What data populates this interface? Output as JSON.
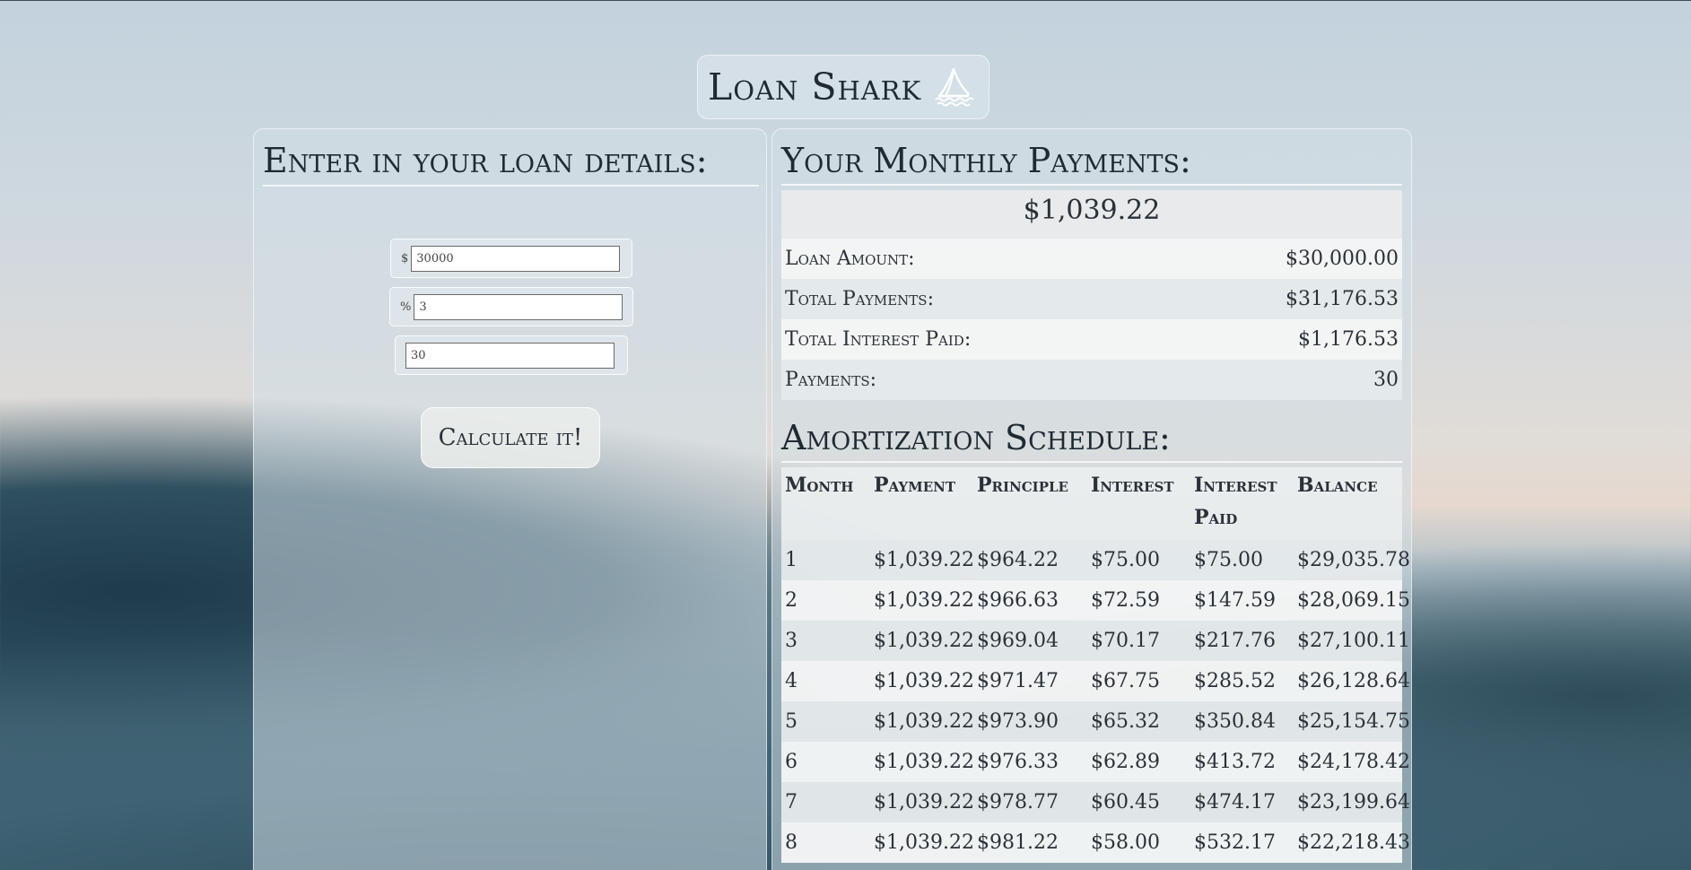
{
  "app": {
    "title": "Loan Shark"
  },
  "form": {
    "heading": "Enter in your loan details:",
    "amount": {
      "prefix": "$",
      "value": "30000"
    },
    "rate": {
      "prefix": "%",
      "value": "3"
    },
    "term": {
      "value": "30"
    },
    "calculate_label": "Calculate it!"
  },
  "results": {
    "heading": "Your Monthly Payments:",
    "monthly_payment": "$1,039.22",
    "summary": [
      {
        "label": "Loan Amount:",
        "value": "$30,000.00"
      },
      {
        "label": "Total Payments:",
        "value": "$31,176.53"
      },
      {
        "label": "Total Interest Paid:",
        "value": "$1,176.53"
      },
      {
        "label": "Payments:",
        "value": "30"
      }
    ]
  },
  "schedule": {
    "heading": "Amortization Schedule:",
    "columns": [
      "Month",
      "Payment",
      "Principle",
      "Interest",
      "Interest Paid",
      "Balance"
    ],
    "rows": [
      [
        "1",
        "$1,039.22",
        "$964.22",
        "$75.00",
        "$75.00",
        "$29,035.78"
      ],
      [
        "2",
        "$1,039.22",
        "$966.63",
        "$72.59",
        "$147.59",
        "$28,069.15"
      ],
      [
        "3",
        "$1,039.22",
        "$969.04",
        "$70.17",
        "$217.76",
        "$27,100.11"
      ],
      [
        "4",
        "$1,039.22",
        "$971.47",
        "$67.75",
        "$285.52",
        "$26,128.64"
      ],
      [
        "5",
        "$1,039.22",
        "$973.90",
        "$65.32",
        "$350.84",
        "$25,154.75"
      ],
      [
        "6",
        "$1,039.22",
        "$976.33",
        "$62.89",
        "$413.72",
        "$24,178.42"
      ],
      [
        "7",
        "$1,039.22",
        "$978.77",
        "$60.45",
        "$474.17",
        "$23,199.64"
      ],
      [
        "8",
        "$1,039.22",
        "$981.22",
        "$58.00",
        "$532.17",
        "$22,218.43"
      ]
    ]
  },
  "icons": {
    "title_icon": "shark-fin-icon"
  }
}
